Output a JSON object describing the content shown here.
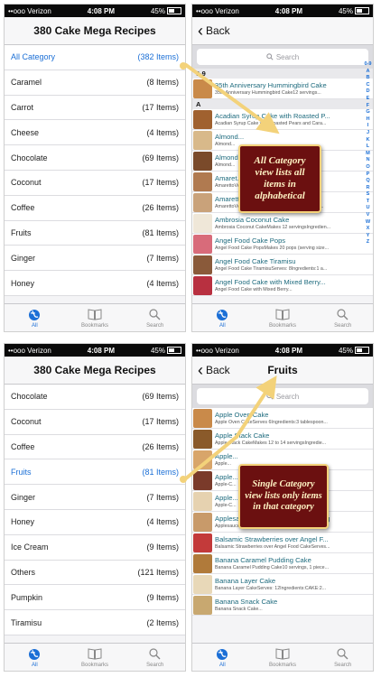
{
  "status": {
    "carrier": "••ooo Verizon",
    "time": "4:08 PM",
    "battery": "45%"
  },
  "screen1": {
    "title": "380 Cake Mega Recipes",
    "categories": [
      {
        "name": "All Category",
        "count": "(382 Items)",
        "highlight": true
      },
      {
        "name": "Caramel",
        "count": "(8 Items)"
      },
      {
        "name": "Carrot",
        "count": "(17 Items)"
      },
      {
        "name": "Cheese",
        "count": "(4 Items)"
      },
      {
        "name": "Chocolate",
        "count": "(69 Items)"
      },
      {
        "name": "Coconut",
        "count": "(17 Items)"
      },
      {
        "name": "Coffee",
        "count": "(26 Items)"
      },
      {
        "name": "Fruits",
        "count": "(81 Items)"
      },
      {
        "name": "Ginger",
        "count": "(7 Items)"
      },
      {
        "name": "Honey",
        "count": "(4 Items)"
      }
    ]
  },
  "screen2": {
    "back_label": "Back",
    "search_placeholder": "Search",
    "sections": [
      {
        "header": "0-9",
        "items": [
          {
            "title": "35th Anniversary Hummingbird Cake",
            "subtitle": "35th Anniversary Hummingbird Cake12 servings...",
            "color": "#c98a4a"
          }
        ]
      },
      {
        "header": "A",
        "items": [
          {
            "title": "Acadian Syrup Cake with Roasted P...",
            "subtitle": "Acadian Syrup Cake with Roasted Pears and Cara...",
            "color": "#a0612f"
          },
          {
            "title": "Almond...",
            "subtitle": "Almond...",
            "color": "#d8b98a"
          },
          {
            "title": "Almond...",
            "subtitle": "Almond...",
            "color": "#7a4a2a"
          },
          {
            "title": "Amaret...",
            "subtitle": "AmarettoVelvet...",
            "color": "#b07a50"
          },
          {
            "title": "Amaretto Velvet Cake",
            "subtitle": "AmarettoVelvetCakeMakes 12 servingsIngredient...",
            "color": "#c9a27a"
          },
          {
            "title": "Ambrosia Coconut Cake",
            "subtitle": "Ambrosia Coconut CakeMakes 12 servingsIngredien...",
            "color": "#efe7d8"
          },
          {
            "title": "Angel Food Cake Pops",
            "subtitle": "Angel Food Cake PopsMakes 20 pops (serving size...",
            "color": "#d86b7a"
          },
          {
            "title": "Angel Food Cake Tiramisu",
            "subtitle": "Angel Food Cake TiramisuServes: 8Ingredients:1 a...",
            "color": "#8a5a3a"
          },
          {
            "title": "Angel Food Cake with Mixed Berry...",
            "subtitle": "Angel Food Cake with Mixed Berry...",
            "color": "#b83040"
          }
        ]
      }
    ],
    "alphabet": [
      "0-9",
      "A",
      "B",
      "C",
      "D",
      "E",
      "F",
      "G",
      "H",
      "I",
      "J",
      "K",
      "L",
      "M",
      "N",
      "O",
      "P",
      "Q",
      "R",
      "S",
      "T",
      "U",
      "V",
      "W",
      "X",
      "Y",
      "Z"
    ]
  },
  "screen3": {
    "title": "380 Cake Mega Recipes",
    "categories": [
      {
        "name": "Chocolate",
        "count": "(69 Items)"
      },
      {
        "name": "Coconut",
        "count": "(17 Items)"
      },
      {
        "name": "Coffee",
        "count": "(26 Items)"
      },
      {
        "name": "Fruits",
        "count": "(81 Items)",
        "highlight": true
      },
      {
        "name": "Ginger",
        "count": "(7 Items)"
      },
      {
        "name": "Honey",
        "count": "(4 Items)"
      },
      {
        "name": "Ice Cream",
        "count": "(9 Items)"
      },
      {
        "name": "Others",
        "count": "(121 Items)"
      },
      {
        "name": "Pumpkin",
        "count": "(9 Items)"
      },
      {
        "name": "Tiramisu",
        "count": "(2 Items)"
      }
    ]
  },
  "screen4": {
    "back_label": "Back",
    "title": "Fruits",
    "search_placeholder": "Search",
    "items": [
      {
        "title": "Apple Oven Cake",
        "subtitle": "Apple Oven CakeServes 6Ingredients:3 tablespoon...",
        "color": "#c98a4a"
      },
      {
        "title": "Apple Stack Cake",
        "subtitle": "Apple Stack CakeMakes 12 to 14 servingsIngredie...",
        "color": "#8a5a2a"
      },
      {
        "title": "Apple...",
        "subtitle": "Apple...",
        "color": "#d8a56a"
      },
      {
        "title": "Apple...",
        "subtitle": "Apple-C...",
        "color": "#7a3a2a"
      },
      {
        "title": "Apple...",
        "subtitle": "Apple-C...",
        "color": "#e6d2b0"
      },
      {
        "title": "Applesauce Cake with Maple Frosting",
        "subtitle": "Applesauce Cake with Maple FrostingServes: 9Ingr...",
        "color": "#c89a6a"
      },
      {
        "title": "Balsamic Strawberries over Angel F...",
        "subtitle": "Balsamic Strawberries over Angel Food CakeServes...",
        "color": "#c33a3a"
      },
      {
        "title": "Banana Caramel Pudding Cake",
        "subtitle": "Banana Caramel Pudding Cake10 servings, 1 piece...",
        "color": "#b07a3a"
      },
      {
        "title": "Banana Layer Cake",
        "subtitle": "Banana Layer CakeServes: 12Ingredients:CAKE:2...",
        "color": "#e8d8b8"
      },
      {
        "title": "Banana Snack Cake",
        "subtitle": "Banana Snack Cake...",
        "color": "#c8a870"
      }
    ]
  },
  "tabs": [
    {
      "label": "All",
      "icon": "globe-icon",
      "active": true
    },
    {
      "label": "Bookmarks",
      "icon": "book-icon"
    },
    {
      "label": "Search",
      "icon": "magnifier-icon"
    }
  ],
  "notes": {
    "all_category": "All Category view lists all items in alphabetical",
    "single_category": "Single Category view lists only items in that category"
  },
  "colors": {
    "accent": "#1b6fd6",
    "recipe_title": "#1e6b7e",
    "note_bg": "#6b1010",
    "note_border": "#f3d27a"
  }
}
